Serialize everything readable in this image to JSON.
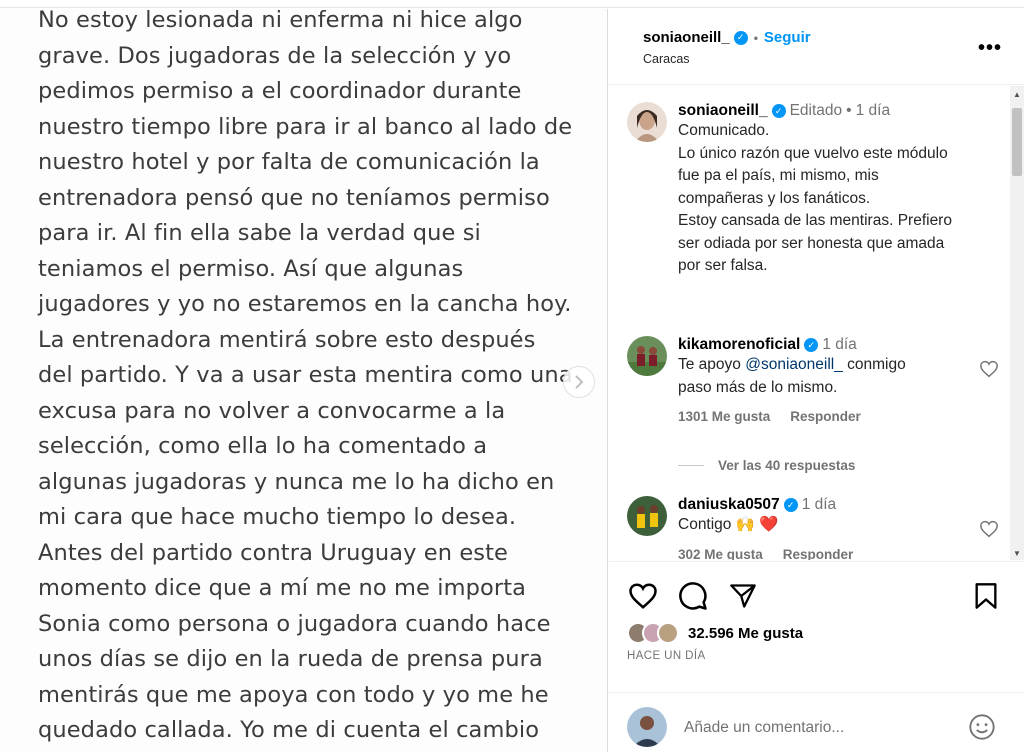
{
  "image_text_lines": [
    "No estoy lesionada ni enferma ni hice algo",
    "grave. Dos jugadoras de la selección y yo",
    "pedimos permiso a el coordinador durante",
    "nuestro tiempo libre para ir al banco al lado de",
    "nuestro hotel y por falta de comunicación la",
    "entrenadora pensó que no teníamos permiso",
    "para ir. Al fin ella sabe la verdad que si",
    "teniamos el permiso. Así que algunas",
    "jugadores y yo no estaremos en la cancha hoy.",
    "La entrenadora mentirá sobre esto después",
    "del partido. Y va a usar esta mentira como una",
    "excusa para no volver a convocarme a la",
    "selección, como ella lo ha comentado a",
    "algunas jugadoras y nunca me lo ha dicho en",
    "mi cara que hace mucho tiempo lo desea.",
    "Antes del partido contra Uruguay en este",
    "momento dice que a  mí me no me importa",
    "Sonia como persona o jugadora cuando hace",
    "unos días se dijo en la rueda de prensa pura",
    "mentirás que me apoya con todo y yo me he",
    "quedado callada. Yo me di cuenta el cambio"
  ],
  "header": {
    "username": "soniaoneill_",
    "follow_label": "Seguir",
    "location": "Caracas"
  },
  "caption": {
    "username": "soniaoneill_",
    "edited": "Editado",
    "time": "1 día",
    "lines": [
      "Comunicado.",
      "Lo único razón que vuelvo este módulo",
      "fue pa el país, mi mismo, mis",
      "compañeras y los fanáticos.",
      "Estoy cansada de las mentiras. Prefiero",
      "ser odiada por ser honesta que amada",
      "por ser falsa."
    ]
  },
  "comments": [
    {
      "username": "kikamorenoficial",
      "time": "1 día",
      "text_prefix": "Te apoyo ",
      "mention": "@soniaoneill_",
      "text_suffix": " conmigo",
      "text_line2": "paso más de lo mismo.",
      "likes": "1301 Me gusta",
      "reply": "Responder",
      "view_replies": "Ver las 40 respuestas"
    },
    {
      "username": "daniuska0507",
      "time": "1 día",
      "text": "Contigo 🙌 ❤️",
      "likes": "302 Me gusta",
      "reply": "Responder"
    }
  ],
  "post": {
    "likes": "32.596 Me gusta",
    "date": "HACE UN DÍA"
  },
  "add_comment_placeholder": "Añade un comentario...",
  "colors": {
    "accent": "#0095f6",
    "muted": "#737373",
    "heart_red": "#ed4956"
  }
}
